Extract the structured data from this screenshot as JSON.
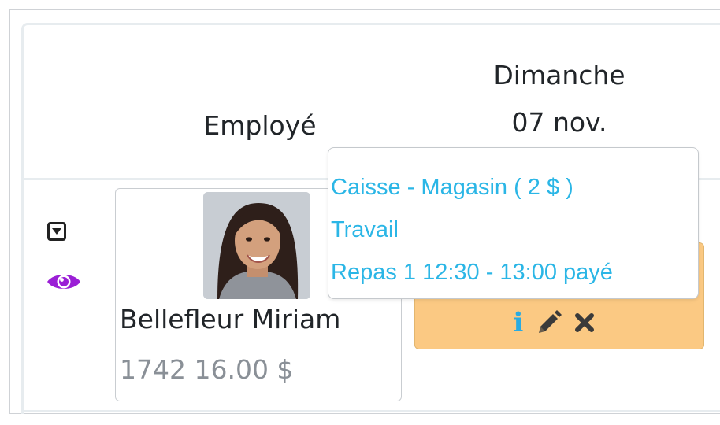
{
  "table": {
    "header": {
      "employee_label": "Employé",
      "day_name": "Dimanche",
      "day_date": "07 nov."
    },
    "rows": [
      {
        "icons": {
          "expand": "caret-down-square-icon",
          "view": "eye-icon"
        },
        "employee": {
          "name": "Bellefleur Miriam",
          "meta": "1742 16.00 $",
          "avatar": "employee-photo"
        },
        "shift": {
          "color": "#fbc983",
          "actions": [
            "info-icon",
            "pencil-icon",
            "close-icon"
          ]
        }
      }
    ]
  },
  "popover": {
    "lines": [
      "Caisse - Magasin ( 2 $ )",
      "Travail",
      "Repas 1 12:30 - 13:00 payé"
    ],
    "text_color": "#2bb6e6"
  },
  "colors": {
    "eye_icon": "#9b1fd6",
    "info_icon": "#29abe2",
    "shift_bg": "#fbc983"
  }
}
